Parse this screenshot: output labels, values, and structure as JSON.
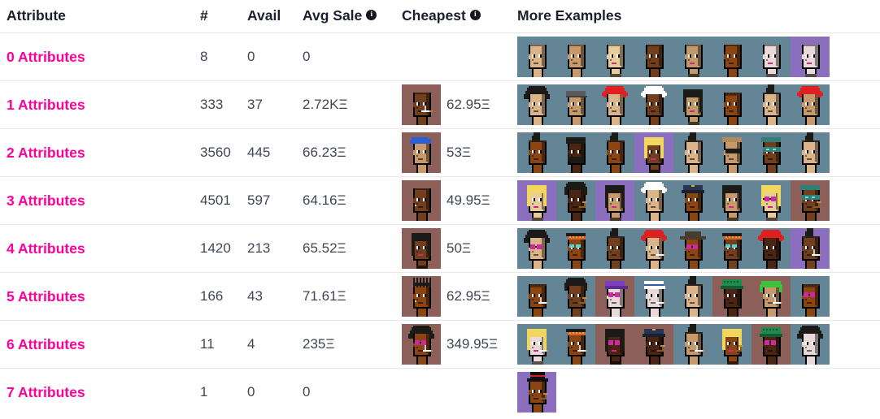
{
  "table": {
    "headers": {
      "attribute": "Attribute",
      "count": "#",
      "avail": "Avail",
      "avg_sale": "Avg Sale",
      "cheapest": "Cheapest",
      "more_examples": "More Examples"
    },
    "header_info_icons": [
      "info-icon",
      "info-icon"
    ],
    "currency_symbol": "Ξ",
    "accent_color": "#ff009c",
    "header_text_color": "#1b1f2e",
    "row_border_color": "#e9e9e9",
    "rows": [
      {
        "attribute": "0 Attributes",
        "count": "8",
        "avail": "0",
        "avg_sale": "0",
        "cheapest_price": "",
        "cheapest_punk": null,
        "examples": [
          {
            "bg": "#638596",
            "skin": "#dcb48a",
            "type": "male-plain"
          },
          {
            "bg": "#638596",
            "skin": "#c8996b",
            "type": "male-plain"
          },
          {
            "bg": "#638596",
            "skin": "#e9cc9b",
            "type": "female-plain"
          },
          {
            "bg": "#638596",
            "skin": "#713f1d",
            "type": "male-plain"
          },
          {
            "bg": "#638596",
            "skin": "#c19a6b",
            "type": "female-plain"
          },
          {
            "bg": "#638596",
            "skin": "#8b4513",
            "type": "male-plain"
          },
          {
            "bg": "#638596",
            "skin": "#ead9d9",
            "type": "female-plain"
          },
          {
            "bg": "#8b6fbe",
            "skin": "#ead9d9",
            "type": "female-plain"
          }
        ]
      },
      {
        "attribute": "1 Attributes",
        "count": "333",
        "avail": "37",
        "avg_sale": "2.72KΞ",
        "cheapest_price": "62.95Ξ",
        "cheapest_punk": {
          "bg": "#8c5f58",
          "skin": "#713f1d",
          "type": "male-cig"
        },
        "examples": [
          {
            "bg": "#638596",
            "skin": "#dcb48a",
            "type": "wild-hair-black"
          },
          {
            "bg": "#638596",
            "skin": "#c8996b",
            "type": "cap-grey"
          },
          {
            "bg": "#638596",
            "skin": "#dcb48a",
            "type": "wild-hair-red"
          },
          {
            "bg": "#638596",
            "skin": "#713f1d",
            "type": "wild-hair-white"
          },
          {
            "bg": "#638596",
            "skin": "#c19a6b",
            "type": "bob-black"
          },
          {
            "bg": "#638596",
            "skin": "#8b4513",
            "type": "shaved"
          },
          {
            "bg": "#638596",
            "skin": "#dcb48a",
            "type": "mohawk-black"
          },
          {
            "bg": "#638596",
            "skin": "#c8996b",
            "type": "mohawk-red"
          }
        ]
      },
      {
        "attribute": "2 Attributes",
        "count": "3560",
        "avail": "445",
        "avg_sale": "66.23Ξ",
        "cheapest_price": "53Ξ",
        "cheapest_punk": {
          "bg": "#8c5f58",
          "skin": "#c8996b",
          "type": "bandana-blue"
        },
        "examples": [
          {
            "bg": "#638596",
            "skin": "#8b4513",
            "type": "mohawk-dark"
          },
          {
            "bg": "#638596",
            "skin": "#4a2511",
            "type": "beard-black"
          },
          {
            "bg": "#638596",
            "skin": "#8b4513",
            "type": "mohawk-dark"
          },
          {
            "bg": "#8b6fbe",
            "skin": "#713f1d",
            "type": "blonde-bob"
          },
          {
            "bg": "#638596",
            "skin": "#dcb48a",
            "type": "mohawk-thin"
          },
          {
            "bg": "#638596",
            "skin": "#c8996b",
            "type": "bandit-mask"
          },
          {
            "bg": "#638596",
            "skin": "#713f1d",
            "type": "welding-goggles"
          },
          {
            "bg": "#638596",
            "skin": "#dcb48a",
            "type": "mohawk-thin"
          }
        ]
      },
      {
        "attribute": "3 Attributes",
        "count": "4501",
        "avail": "597",
        "avg_sale": "64.16Ξ",
        "cheapest_price": "49.95Ξ",
        "cheapest_punk": {
          "bg": "#8c5f58",
          "skin": "#713f1d",
          "type": "male-earring"
        },
        "examples": [
          {
            "bg": "#8b6fbe",
            "skin": "#e9cc9b",
            "type": "blonde-bob"
          },
          {
            "bg": "#638596",
            "skin": "#4a2511",
            "type": "wild-pipe"
          },
          {
            "bg": "#8b6fbe",
            "skin": "#c8996b",
            "type": "straight-dark"
          },
          {
            "bg": "#638596",
            "skin": "#dcb48a",
            "type": "wild-hair-white"
          },
          {
            "bg": "#638596",
            "skin": "#8b4513",
            "type": "police-cap"
          },
          {
            "bg": "#638596",
            "skin": "#c8996b",
            "type": "straight-dark"
          },
          {
            "bg": "#638596",
            "skin": "#e9cc9b",
            "type": "blonde-shades"
          },
          {
            "bg": "#8c5f58",
            "skin": "#713f1d",
            "type": "welding-pipe"
          }
        ]
      },
      {
        "attribute": "4 Attributes",
        "count": "1420",
        "avail": "213",
        "avg_sale": "65.52Ξ",
        "cheapest_price": "50Ξ",
        "cheapest_punk": {
          "bg": "#8c5f58",
          "skin": "#713f1d",
          "type": "straight-dark"
        },
        "examples": [
          {
            "bg": "#638596",
            "skin": "#dcb48a",
            "type": "wild-shades"
          },
          {
            "bg": "#638596",
            "skin": "#8b4513",
            "type": "headband-eyes"
          },
          {
            "bg": "#638596",
            "skin": "#713f1d",
            "type": "mohawk-dark"
          },
          {
            "bg": "#638596",
            "skin": "#dcb48a",
            "type": "wild-hair-red-cig"
          },
          {
            "bg": "#638596",
            "skin": "#8b4513",
            "type": "fedora-shades"
          },
          {
            "bg": "#638596",
            "skin": "#713f1d",
            "type": "headband-eyes"
          },
          {
            "bg": "#638596",
            "skin": "#4a2511",
            "type": "wild-hair-red-beard"
          },
          {
            "bg": "#8b6fbe",
            "skin": "#713f1d",
            "type": "mohawk-cig"
          }
        ]
      },
      {
        "attribute": "5 Attributes",
        "count": "166",
        "avail": "43",
        "avg_sale": "71.61Ξ",
        "cheapest_price": "62.95Ξ",
        "cheapest_punk": {
          "bg": "#8c5f58",
          "skin": "#8b4513",
          "type": "dreads-earring"
        },
        "examples": [
          {
            "bg": "#638596",
            "skin": "#8b4513",
            "type": "shaved-cig"
          },
          {
            "bg": "#638596",
            "skin": "#713f1d",
            "type": "wild-pipe"
          },
          {
            "bg": "#8c5f58",
            "skin": "#ead9d9",
            "type": "purple-cap-shades"
          },
          {
            "bg": "#638596",
            "skin": "#ead9d9",
            "type": "sailor-cap-cig"
          },
          {
            "bg": "#638596",
            "skin": "#dcb48a",
            "type": "mohawk-thin"
          },
          {
            "bg": "#8c5f58",
            "skin": "#4a2511",
            "type": "knit-cap-green"
          },
          {
            "bg": "#8c5f58",
            "skin": "#c8996b",
            "type": "green-hair-cig"
          },
          {
            "bg": "#638596",
            "skin": "#8b4513",
            "type": "shaved-shades"
          }
        ]
      },
      {
        "attribute": "6 Attributes",
        "count": "11",
        "avail": "4",
        "avg_sale": "235Ξ",
        "cheapest_price": "349.95Ξ",
        "cheapest_punk": {
          "bg": "#8c5f58",
          "skin": "#8b4513",
          "type": "wild-shades-cig"
        },
        "examples": [
          {
            "bg": "#638596",
            "skin": "#ead9d9",
            "type": "blonde-cig"
          },
          {
            "bg": "#638596",
            "skin": "#8b4513",
            "type": "headband-cig"
          },
          {
            "bg": "#8c5f58",
            "skin": "#4a2511",
            "type": "straight-dark-glasses"
          },
          {
            "bg": "#8c5f58",
            "skin": "#4a2511",
            "type": "cap-pipe"
          },
          {
            "bg": "#638596",
            "skin": "#c8996b",
            "type": "mohawk-cig"
          },
          {
            "bg": "#638596",
            "skin": "#8b4513",
            "type": "blonde-pipe"
          },
          {
            "bg": "#8c5f58",
            "skin": "#4a2511",
            "type": "knit-cap-shades"
          },
          {
            "bg": "#638596",
            "skin": "#ead9d9",
            "type": "wild-black-clown"
          }
        ]
      },
      {
        "attribute": "7 Attributes",
        "count": "1",
        "avail": "0",
        "avg_sale": "0",
        "cheapest_price": "",
        "cheapest_punk": null,
        "examples": [
          {
            "bg": "#8b6fbe",
            "skin": "#8b4513",
            "type": "tophat-pipe"
          }
        ]
      }
    ]
  }
}
